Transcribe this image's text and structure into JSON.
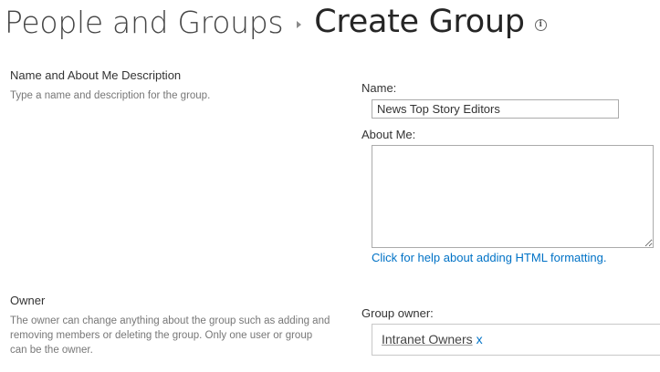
{
  "header": {
    "breadcrumb": "People and Groups",
    "title": "Create Group"
  },
  "sections": {
    "name_about": {
      "title": "Name and About Me Description",
      "description": "Type a name and description for the group.",
      "name_label": "Name:",
      "name_value": "News Top Story Editors",
      "about_label": "About Me:",
      "about_value": "",
      "help_link": "Click for help about adding HTML formatting."
    },
    "owner": {
      "title": "Owner",
      "description_lines": [
        "The owner can change anything about the group such as adding and",
        "removing members or deleting the group. Only one user or group",
        "can be the owner."
      ],
      "field_label": "Group owner:",
      "owner_name": "Intranet Owners",
      "remove_label": "x"
    }
  },
  "colors": {
    "link": "#0072c6",
    "heading": "#262626",
    "border": "#ababab"
  },
  "icons": {
    "breadcrumb_separator": "chevron-right-icon",
    "info": "info-icon"
  }
}
